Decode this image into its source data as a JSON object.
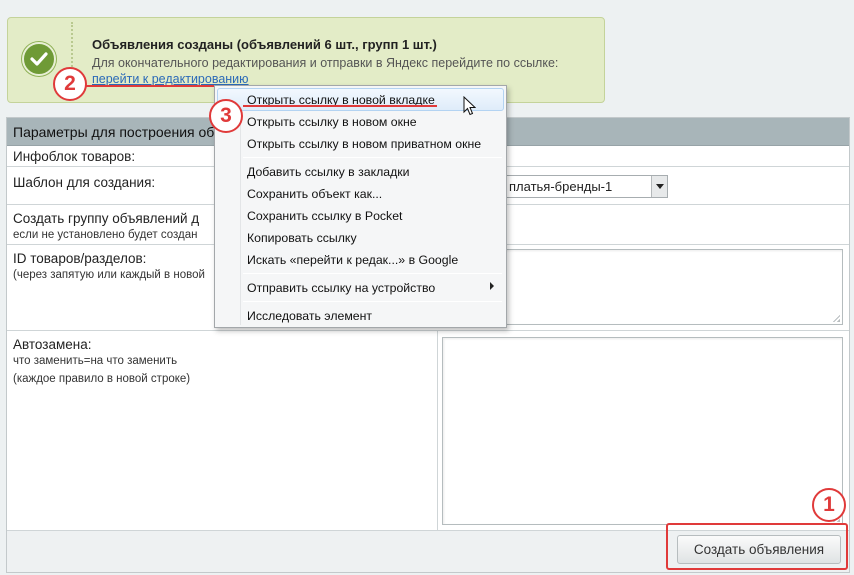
{
  "notice": {
    "title": "Объявления созданы (объявлений 6 шт., групп 1 шт.)",
    "text": "Для окончательного редактирования и отправки в Яндекс перейдите по ссылке:",
    "link": "перейти к редактированию"
  },
  "form": {
    "header": "Параметры для построения об",
    "infoblock_label": "Инфоблок товаров:",
    "template_label": "Шаблон для создания:",
    "template_value": "платья-бренды-1",
    "group_label": "Создать группу объявлений д",
    "group_hint": "если не установлено будет создан",
    "ids_label": "ID товаров/разделов:",
    "ids_hint": "(через запятую или каждый в новой",
    "autoreplace_label": "Автозамена:",
    "autoreplace_hint1": "что заменить=на что заменить",
    "autoreplace_hint2": "(каждое правило в новой строке)",
    "create_button": "Создать объявления"
  },
  "context_menu": {
    "items": [
      "Открыть ссылку в новой вкладке",
      "Открыть ссылку в новом окне",
      "Открыть ссылку в новом приватном окне",
      "Добавить ссылку в закладки",
      "Сохранить объект как...",
      "Сохранить ссылку в Pocket",
      "Копировать ссылку",
      "Искать «перейти к редак...» в Google",
      "Отправить ссылку на устройство",
      "Исследовать элемент"
    ]
  },
  "annotations": {
    "badge1": "1",
    "badge2": "2",
    "badge3": "3"
  },
  "colors": {
    "annotation": "#e03a3a",
    "link": "#2b6ab8",
    "notice_bg": "#e3ecc7",
    "success": "#6f9a36"
  }
}
